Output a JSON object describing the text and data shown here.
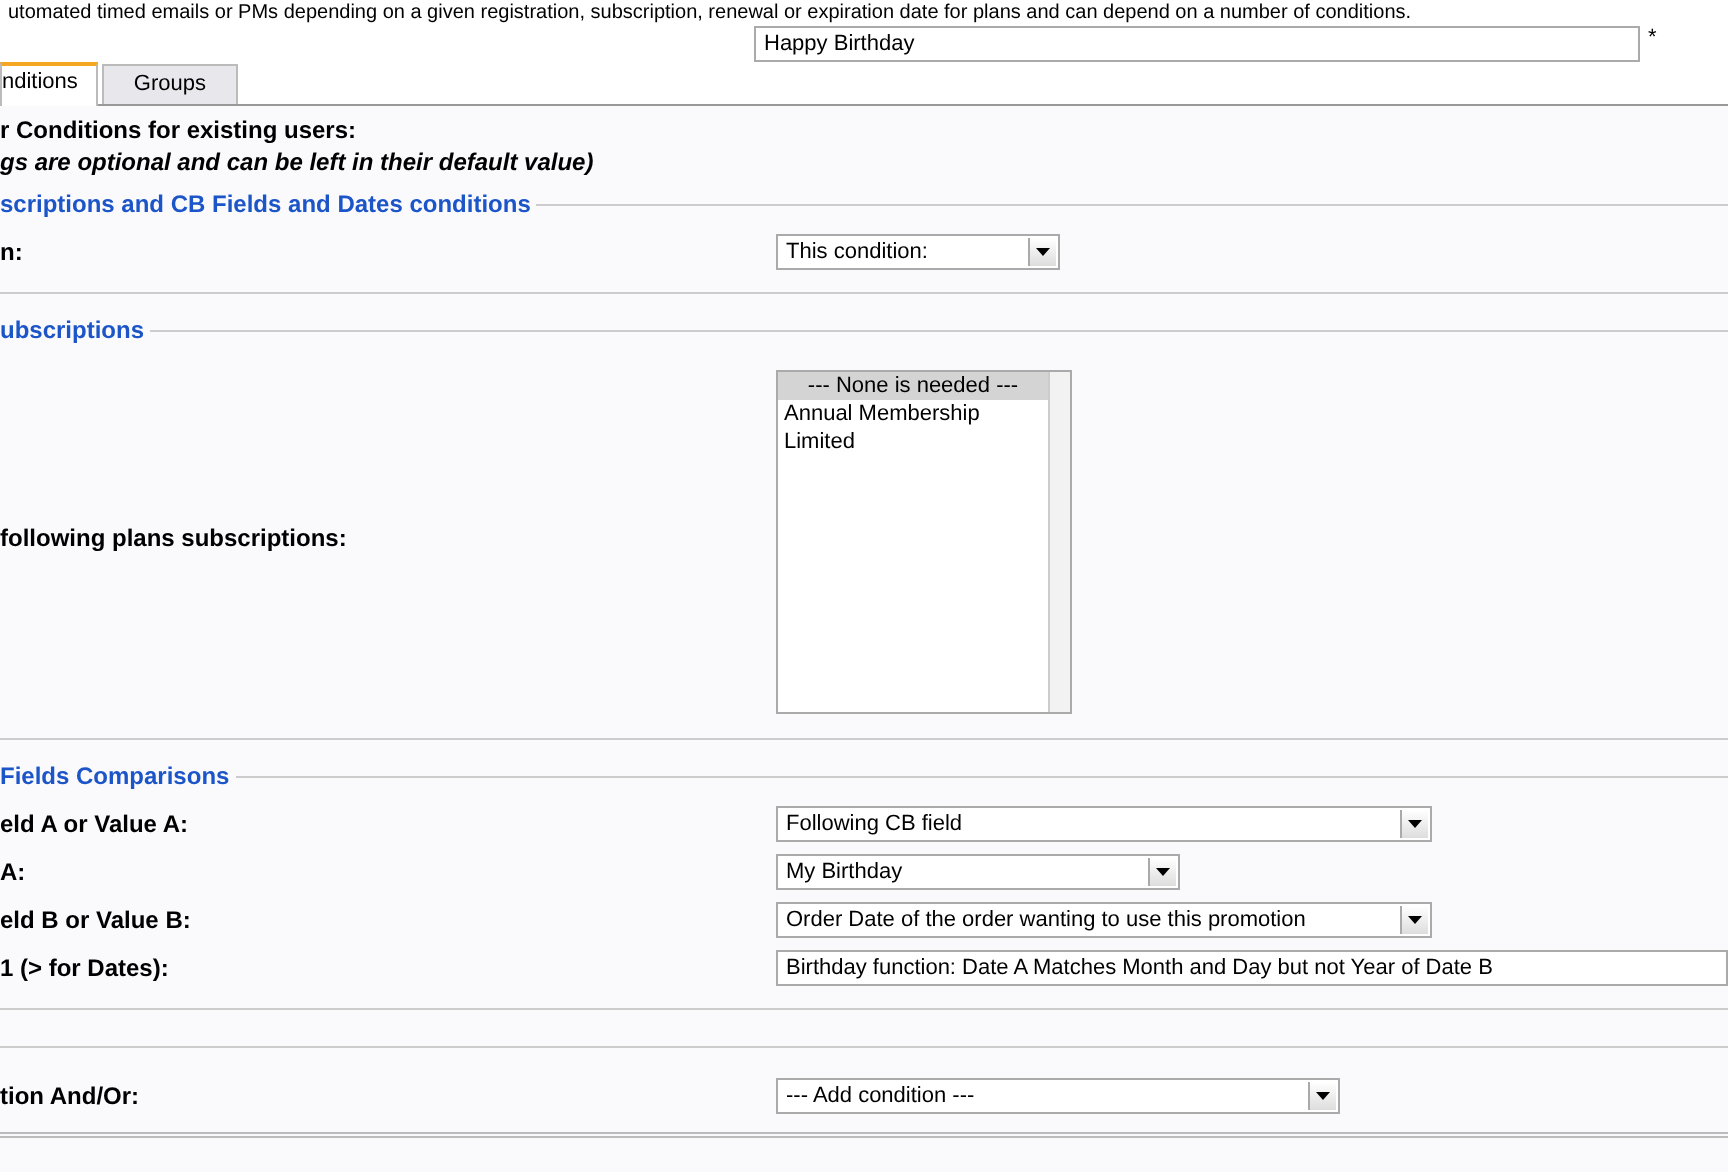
{
  "description": "utomated timed emails or PMs depending on a given registration, subscription, renewal or expiration date for plans and can depend on a number of conditions.",
  "name_field": {
    "value": "Happy Birthday",
    "required_mark": "*"
  },
  "tabs": [
    {
      "label": "nditions",
      "selected": true
    },
    {
      "label": "Groups",
      "selected": false
    }
  ],
  "heading": "r Conditions for existing users:",
  "note": "gs are optional and can be left in their default value)",
  "sections": [
    {
      "legend": "scriptions and CB Fields and Dates conditions",
      "rows": [
        {
          "label": "n:",
          "kind": "dropdown",
          "value": "This condition:"
        }
      ]
    },
    {
      "legend": "ubscriptions",
      "rows": [
        {
          "label": "following plans subscriptions:",
          "kind": "listbox",
          "options": [
            {
              "label": "--- None is needed ---",
              "selected": true
            },
            {
              "label": "Annual Membership",
              "selected": false
            },
            {
              "label": "Limited",
              "selected": false
            }
          ]
        }
      ]
    },
    {
      "legend": "Fields Comparisons",
      "rows": [
        {
          "label": "eld A or Value A:",
          "kind": "dropdown",
          "value": "Following CB field"
        },
        {
          "label": "A:",
          "kind": "dropdown",
          "value": "My Birthday"
        },
        {
          "label": "eld B or Value B:",
          "kind": "dropdown",
          "value": "Order Date of the order wanting to use this promotion"
        },
        {
          "label": "1 (> for Dates):",
          "kind": "text",
          "value": "Birthday function: Date A Matches Month and Day but not Year of Date B"
        }
      ]
    },
    {
      "rows": [
        {
          "label": "tion And/Or:",
          "kind": "dropdown",
          "value": "--- Add condition ---"
        }
      ]
    }
  ]
}
